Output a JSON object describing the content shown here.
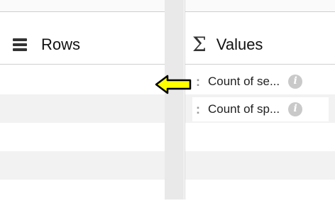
{
  "rows_panel": {
    "title": "Rows",
    "icon": "rows-icon"
  },
  "values_panel": {
    "title": "Values",
    "icon": "sigma-icon",
    "items": [
      {
        "label": "Count of se...",
        "icon": "info-icon"
      },
      {
        "label": "Count of sp...",
        "icon": "info-icon"
      }
    ]
  },
  "annotation": {
    "icon": "yellow-arrow-left-icon",
    "color": "#ffff00"
  }
}
